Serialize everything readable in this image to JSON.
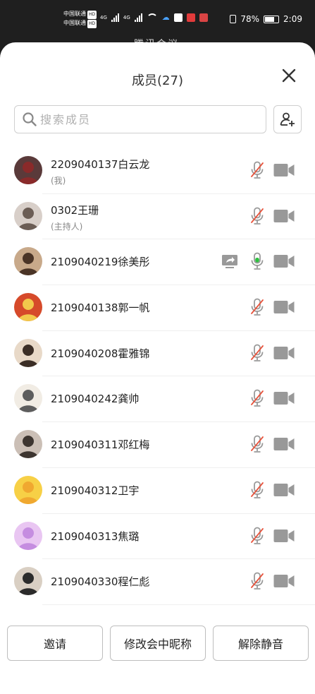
{
  "status_bar": {
    "carrier1": "中国联通",
    "carrier2": "中国联通",
    "hd": "HD",
    "net1": "4G",
    "net2": "4G",
    "battery_percent": "78%",
    "time": "2:09"
  },
  "behind_title": "腾讯会议",
  "panel": {
    "title": "成员(27)",
    "search_placeholder": "搜索成员"
  },
  "members": [
    {
      "name": "2209040137白云龙",
      "role": "(我)",
      "mic": "muted",
      "camera": "off",
      "screen_share": false
    },
    {
      "name": "0302王珊",
      "role": "(主持人)",
      "mic": "muted",
      "camera": "off",
      "screen_share": false
    },
    {
      "name": "2109040219徐美彤",
      "role": "",
      "mic": "on",
      "camera": "off",
      "screen_share": true
    },
    {
      "name": "2109040138郭一帆",
      "role": "",
      "mic": "muted",
      "camera": "off",
      "screen_share": false
    },
    {
      "name": "2109040208霍雅锦",
      "role": "",
      "mic": "muted",
      "camera": "off",
      "screen_share": false
    },
    {
      "name": "2109040242龚帅",
      "role": "",
      "mic": "muted",
      "camera": "off",
      "screen_share": false
    },
    {
      "name": "2109040311邓红梅",
      "role": "",
      "mic": "muted",
      "camera": "off",
      "screen_share": false
    },
    {
      "name": "2109040312卫宇",
      "role": "",
      "mic": "muted",
      "camera": "off",
      "screen_share": false
    },
    {
      "name": "2109040313焦璐",
      "role": "",
      "mic": "muted",
      "camera": "off",
      "screen_share": false
    },
    {
      "name": "2109040330程仁彪",
      "role": "",
      "mic": "muted",
      "camera": "off",
      "screen_share": false
    }
  ],
  "buttons": {
    "invite": "邀请",
    "rename": "修改会中昵称",
    "unmute": "解除静音"
  },
  "colors": {
    "mic_muted_slash": "#e8533c",
    "mic_on_level": "#2cc13f",
    "icon_gray": "#999999"
  }
}
